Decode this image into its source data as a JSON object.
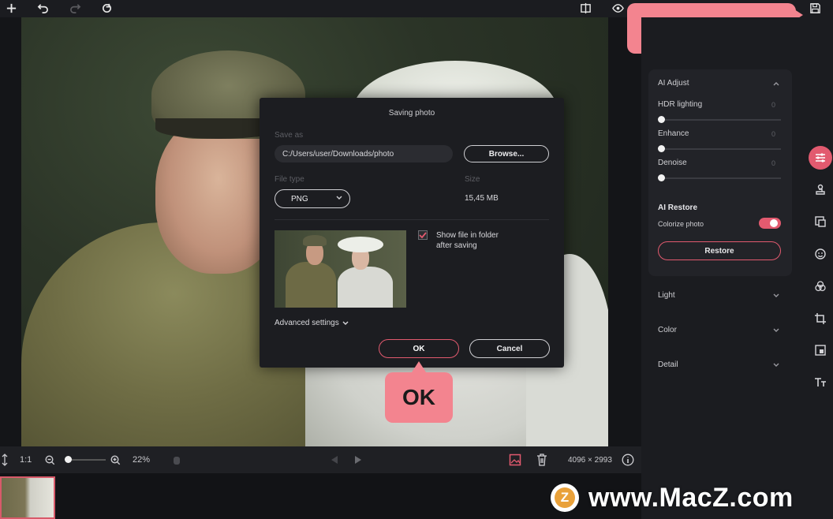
{
  "colors": {
    "accent": "#e25a6f",
    "callout": "#f3848f",
    "panel": "#222328",
    "dialog": "#1c1d21"
  },
  "toolbar_top": {
    "icons": [
      "plus-icon",
      "undo-icon",
      "redo-icon",
      "reset-icon",
      "compare-icon",
      "eye-icon",
      "floppy-disk-icon"
    ]
  },
  "dialog": {
    "title": "Saving photo",
    "save_as_label": "Save as",
    "path": "C:/Users/user/Downloads/photo",
    "browse": "Browse...",
    "file_type_label": "File type",
    "file_type": "PNG",
    "size_label": "Size",
    "size": "15,45 MB",
    "checkbox_label_line1": "Show file in folder",
    "checkbox_label_line2": "after saving",
    "show_in_folder_checked": true,
    "advanced": "Advanced settings",
    "ok": "OK",
    "cancel": "Cancel"
  },
  "right_panel": {
    "ai_adjust": "AI Adjust",
    "sliders": [
      {
        "label": "HDR lighting",
        "value": "0",
        "level": 0
      },
      {
        "label": "Enhance",
        "value": "0",
        "level": 0
      },
      {
        "label": "Denoise",
        "value": "0",
        "level": 0
      }
    ],
    "ai_restore": "AI Restore",
    "colorize_label": "Colorize photo",
    "colorize_on": true,
    "restore_button": "Restore",
    "sections": [
      "Light",
      "Color",
      "Detail"
    ]
  },
  "side_tools": [
    "adjust-icon",
    "stamp-icon",
    "replace-icon",
    "face-icon",
    "color-icon",
    "crop-icon",
    "resize-icon",
    "text-icon"
  ],
  "bottom_bar": {
    "ratio": "1:1",
    "zoom": "22%",
    "dimensions": "4096 × 2993"
  },
  "callouts": {
    "floppy": "Floppy disk",
    "ok": "OK"
  },
  "watermark": {
    "logo_letter": "Z",
    "text": "www.MacZ.com"
  }
}
